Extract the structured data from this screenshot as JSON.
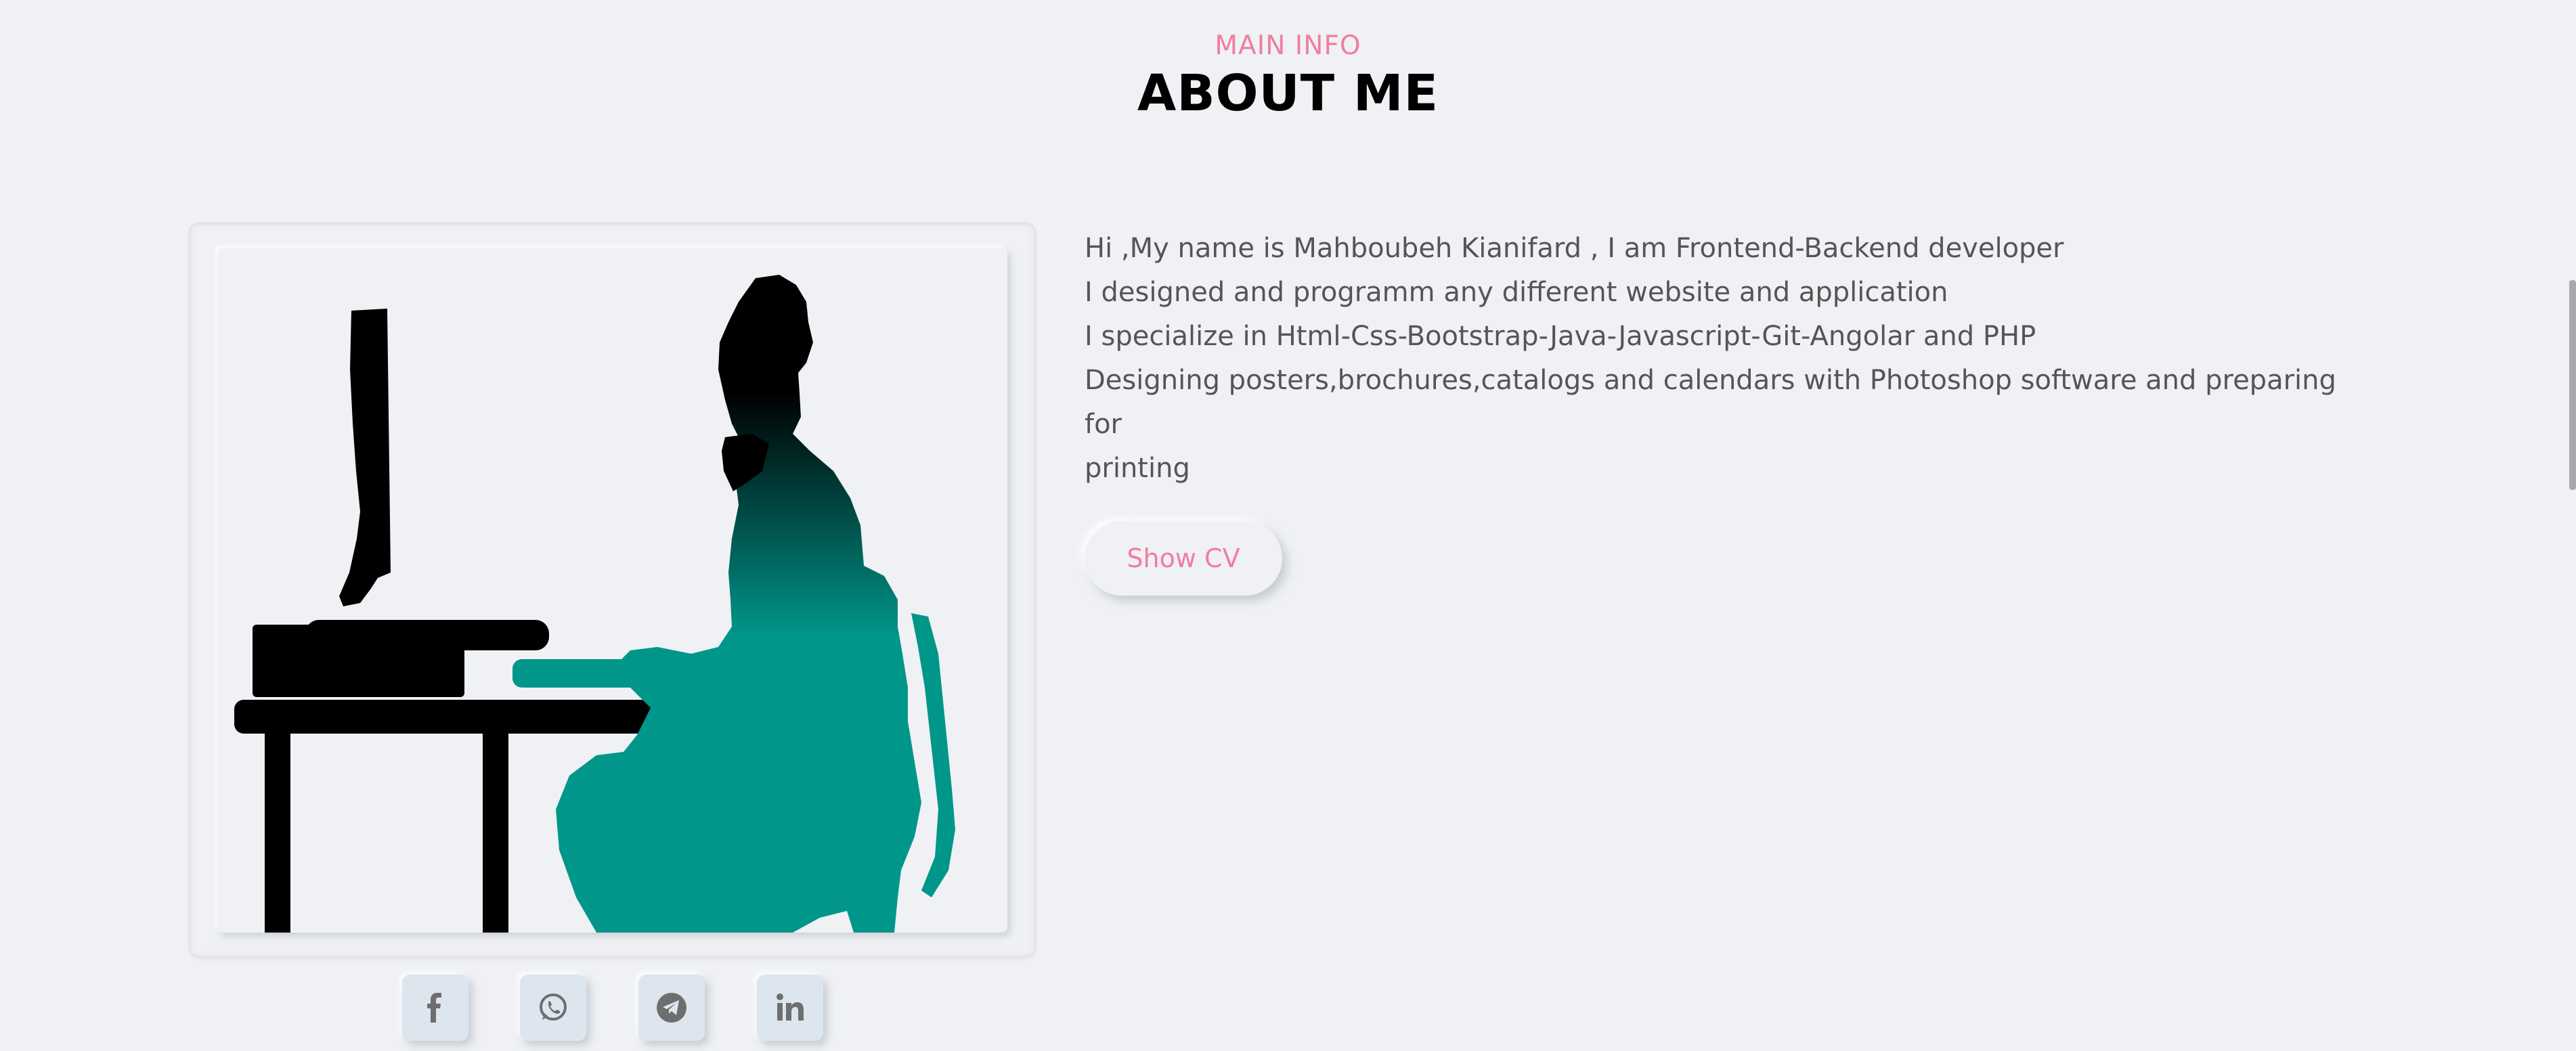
{
  "section": {
    "kicker": "MAIN INFO",
    "title": "ABOUT ME"
  },
  "bio": {
    "lines": [
      "Hi ,My name is Mahboubeh Kianifard , I am Frontend-Backend developer",
      "I designed and programm any different website and application",
      "I specialize in Html-Css-Bootstrap-Java-Javascript-Git-Angolar and PHP",
      "Designing posters,brochures,catalogs and calendars with Photoshop software and preparing for",
      "printing"
    ]
  },
  "actions": {
    "show_cv_label": "Show CV"
  },
  "socials": [
    {
      "icon": "facebook-icon"
    },
    {
      "icon": "whatsapp-icon"
    },
    {
      "icon": "telegram-icon"
    },
    {
      "icon": "linkedin-icon"
    }
  ],
  "colors": {
    "background": "#eff1f4",
    "accent": "#f07da0",
    "title": "#000000",
    "body_text": "#555555",
    "illustration_teal": "#00968a",
    "social_button_bg": "#dde6ef",
    "social_icon": "#6e6e6e"
  }
}
